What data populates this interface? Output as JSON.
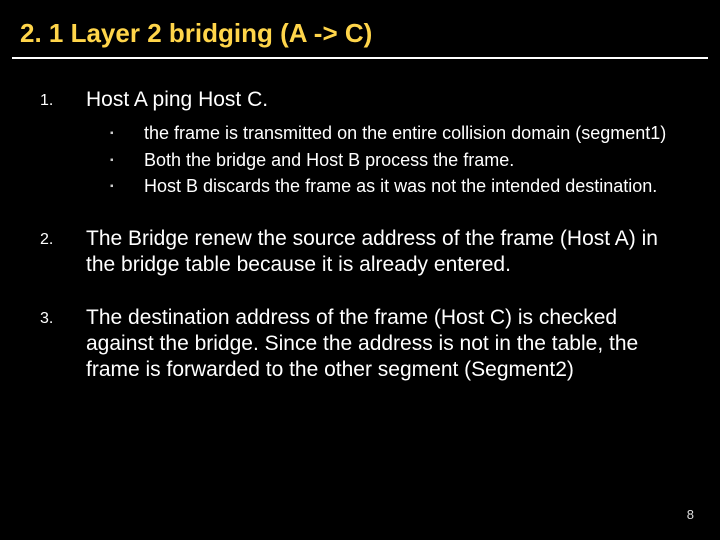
{
  "title": {
    "main": "2. 1 Layer 2 bridging",
    "paren": "(A -> C)"
  },
  "items": [
    {
      "num": "1.",
      "text": "Host A ping Host C.",
      "sub": [
        "the frame is transmitted on the entire collision domain (segment1)",
        "Both the bridge and Host B process the frame.",
        "Host B discards the frame as it was not the intended destination."
      ]
    },
    {
      "num": "2.",
      "text": "The Bridge renew the source address of the frame (Host A) in the bridge table because it is already entered."
    },
    {
      "num": "3.",
      "text": "The destination address of the frame (Host C) is checked against the bridge. Since the address is not in the table, the frame is forwarded to the other segment (Segment2)"
    }
  ],
  "page_number": "8"
}
